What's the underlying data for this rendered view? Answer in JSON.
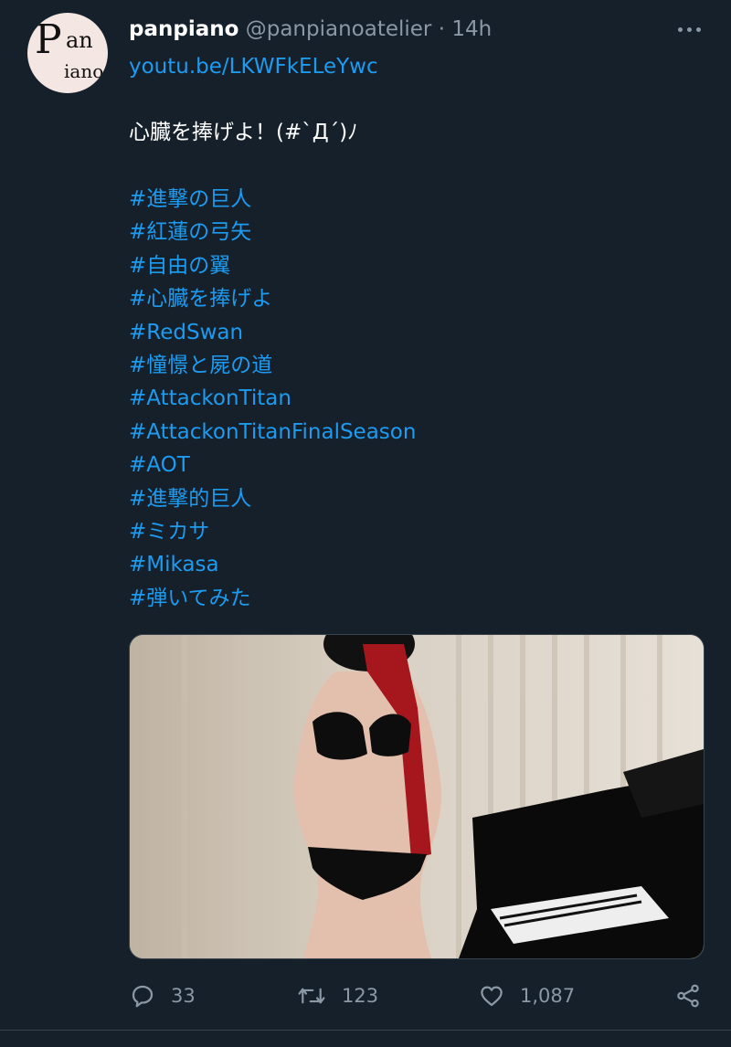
{
  "author": {
    "display_name": "panpiano",
    "handle": "@panpianoatelier",
    "separator": "·",
    "time": "14h",
    "avatar_logo": {
      "letter": "P",
      "top_text": "an",
      "bottom_text": "iano"
    }
  },
  "tweet": {
    "link": "youtu.be/LKWFkELeYwc",
    "text": "心臓を捧げよ！(#`Д´)ﾉ",
    "hashtags": [
      "#進撃の巨人",
      "#紅蓮の弓矢",
      "#自由の翼",
      "#心臓を捧げよ",
      "#RedSwan",
      "#憧憬と屍の道",
      "#AttackonTitan",
      "#AttackonTitanFinalSeason",
      "#AOT",
      "#進撃的巨人",
      "#ミカサ",
      "#Mikasa",
      "#弾いてみた"
    ]
  },
  "actions": {
    "reply_count": "33",
    "retweet_count": "123",
    "like_count": "1,087"
  },
  "icons": {
    "more": "more-horizontal-icon",
    "reply": "reply-icon",
    "retweet": "retweet-icon",
    "like": "heart-icon",
    "share": "share-icon"
  },
  "colors": {
    "background": "#15202b",
    "accent": "#1d9bf0",
    "muted": "#8b98a5",
    "text": "#ffffff"
  }
}
